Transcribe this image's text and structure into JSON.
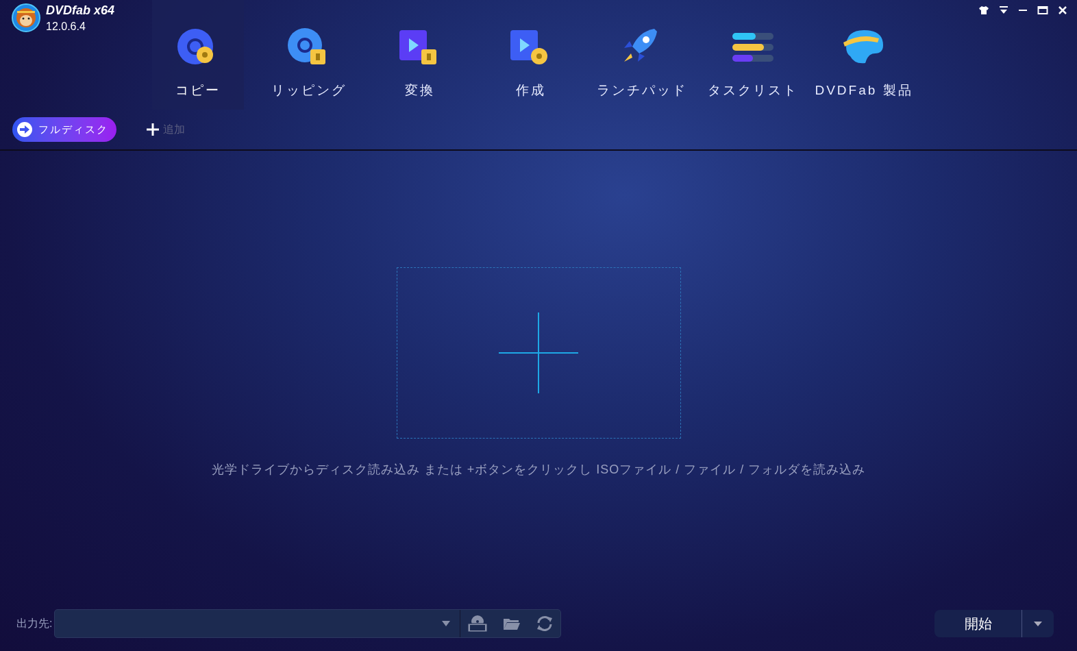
{
  "app": {
    "name": "DVDfab x64",
    "version": "12.0.6.4"
  },
  "nav": [
    {
      "label": "コピー",
      "kind": "copy",
      "selected": true
    },
    {
      "label": "リッピング",
      "kind": "ripper",
      "selected": false
    },
    {
      "label": "変換",
      "kind": "converter",
      "selected": false
    },
    {
      "label": "作成",
      "kind": "creator",
      "selected": false
    },
    {
      "label": "ランチパッド",
      "kind": "launchpad",
      "selected": false
    },
    {
      "label": "タスクリスト",
      "kind": "tasks",
      "selected": false
    },
    {
      "label": "DVDFab 製品",
      "kind": "products",
      "selected": false
    }
  ],
  "mode_button": {
    "label": "フルディスク"
  },
  "add_button": {
    "label": "追加"
  },
  "drop_hint": "光学ドライブからディスク読み込み または +ボタンをクリックし ISOファイル / ファイル / フォルダを読み込み",
  "output": {
    "label": "出力先:"
  },
  "start_button": {
    "label": "開始"
  }
}
